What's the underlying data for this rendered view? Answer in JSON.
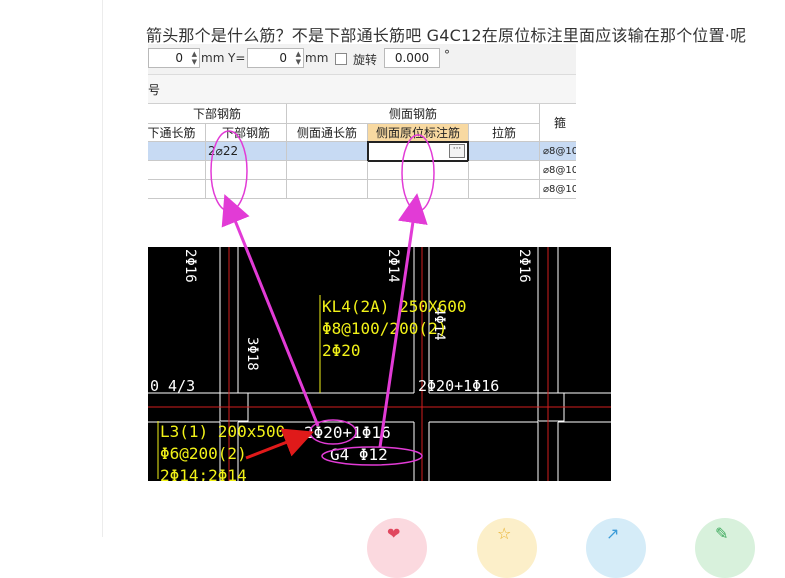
{
  "question": "箭头那个是什么筋？不是下部通长筋吧 G4C12在原位标注里面应该输在那个位置·呢",
  "toolbar": {
    "x_value": "0",
    "x_unit": "mm",
    "y_label": "Y=",
    "y_value": "0",
    "y_unit": "mm",
    "rotate_label": "旋转",
    "rotate_value": "0.000",
    "degree": "°"
  },
  "subbar_label": "号",
  "table": {
    "group_bottom": "下部钢筋",
    "group_side": "侧面钢筋",
    "col_bottom_cont": "下通长筋",
    "col_bottom": "下部钢筋",
    "col_side_cont": "侧面通长筋",
    "col_side_orig": "侧面原位标注筋",
    "col_tie": "拉筋",
    "col_stirrup": "箍",
    "row1_bottom": "2⌀22",
    "stirrup_1": "⌀8@10",
    "stirrup_2": "⌀8@10",
    "stirrup_3": "⌀8@10",
    "ellipsis": "···"
  },
  "cad": {
    "v_2c16_left": "2Φ16",
    "v_2c14": "2Φ14",
    "v_2c16_right": "2Φ16",
    "v_3c18": "3Φ18",
    "v_4c14": "4Φ14",
    "kl4_line1": "KL4(2A) 250X600",
    "kl4_line2": "Φ8@100/200(2)",
    "kl4_line3": "2Φ20",
    "left_frag": "0 4/3",
    "mid_bars": "2Φ20+1Φ16",
    "l3_line1": "L3(1) 200x500",
    "l3_line2": "Φ6@200(2)",
    "l3_line3": "2Φ14;2Φ14",
    "bars_main": "2Φ20+1Φ16",
    "g4": "G4 Φ12"
  },
  "colors": {
    "magenta": "#e23bd6",
    "arrow_red": "#e01a1a",
    "cad_yellow": "#f2f218",
    "cad_white": "#ffffff",
    "cad_red": "#d21e1e",
    "header_orange": "#f8d9a1",
    "selected_blue": "#c7daf3"
  }
}
